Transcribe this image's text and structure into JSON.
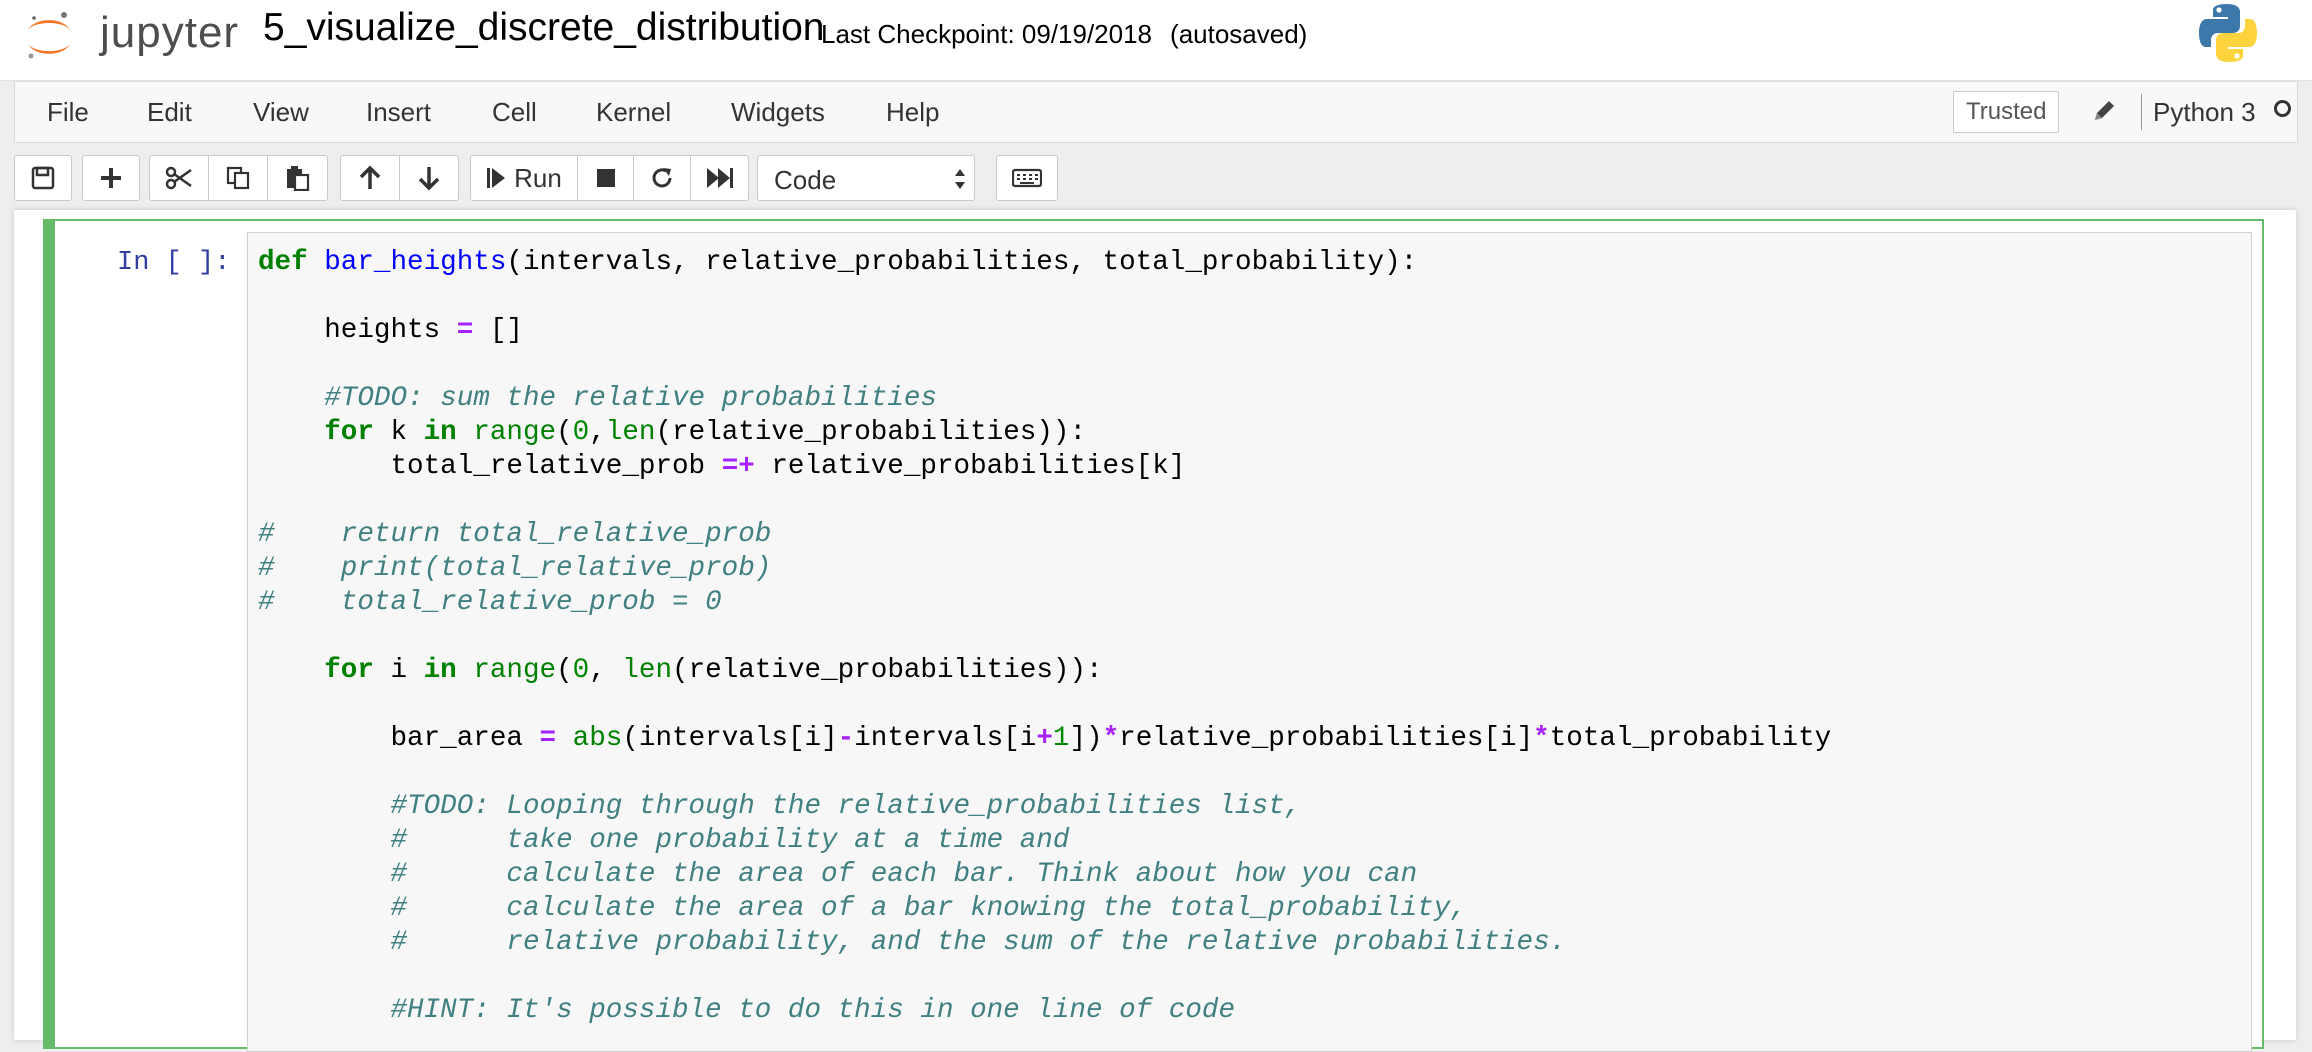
{
  "header": {
    "logo_text": "jupyter",
    "notebook_title": "5_visualize_discrete_distribution",
    "checkpoint": "Last Checkpoint: 09/19/2018",
    "autosave": "(autosaved)"
  },
  "menubar": {
    "items": [
      "File",
      "Edit",
      "View",
      "Insert",
      "Cell",
      "Kernel",
      "Widgets",
      "Help"
    ],
    "trusted": "Trusted",
    "kernel_name": "Python 3"
  },
  "toolbar": {
    "run_label": "Run",
    "cell_type": "Code"
  },
  "cell": {
    "prompt": "In [ ]:",
    "code_lines": [
      "def bar_heights(intervals, relative_probabilities, total_probability):",
      "",
      "    heights = []",
      "",
      "    #TODO: sum the relative probabilities",
      "    for k in range(0,len(relative_probabilities)):",
      "        total_relative_prob =+ relative_probabilities[k]",
      "",
      "#    return total_relative_prob",
      "#    print(total_relative_prob)",
      "#    total_relative_prob = 0",
      "",
      "    for i in range(0, len(relative_probabilities)):",
      "",
      "        bar_area = abs(intervals[i]-intervals[i+1])*relative_probabilities[i]*total_probability",
      "",
      "        #TODO: Looping through the relative_probabilities list,",
      "        #      take one probability at a time and",
      "        #      calculate the area of each bar. Think about how you can",
      "        #      calculate the area of a bar knowing the total_probability,",
      "        #      relative probability, and the sum of the relative probabilities.",
      "",
      "        #HINT: It's possible to do this in one line of code"
    ]
  },
  "colors": {
    "cell_selected_border": "#66bb6a",
    "prompt_in": "#303f9f",
    "keyword": "#008000",
    "function_name": "#0000ff",
    "operator": "#aa22ff",
    "comment": "#408080",
    "jupyter_orange": "#f37726"
  }
}
